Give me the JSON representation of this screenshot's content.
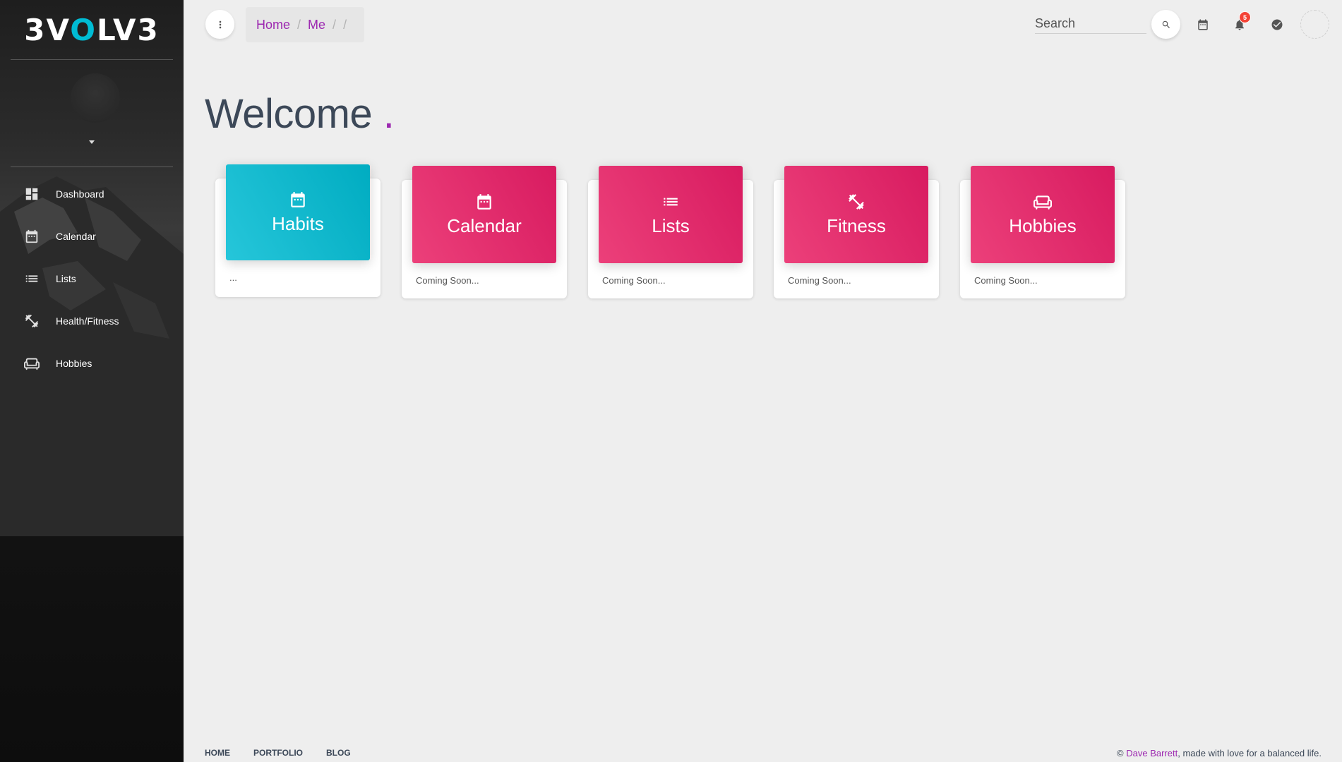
{
  "brand": {
    "left": "3V",
    "accent": "O",
    "right": "LV3"
  },
  "sidebar": {
    "items": [
      {
        "label": "Dashboard",
        "icon": "dashboard-icon"
      },
      {
        "label": "Calendar",
        "icon": "calendar-icon"
      },
      {
        "label": "Lists",
        "icon": "list-icon"
      },
      {
        "label": "Health/Fitness",
        "icon": "fitness-icon"
      },
      {
        "label": "Hobbies",
        "icon": "sofa-icon"
      }
    ]
  },
  "breadcrumb": {
    "items": [
      "Home",
      "Me"
    ],
    "separator": "/"
  },
  "search": {
    "placeholder": "Search"
  },
  "notifications": {
    "count": "5"
  },
  "welcome": {
    "text": "Welcome",
    "dot": "."
  },
  "cards": [
    {
      "title": "Habits",
      "footer": "...",
      "icon": "calendar-icon",
      "color": "#00bcd4"
    },
    {
      "title": "Calendar",
      "footer": "Coming Soon...",
      "icon": "calendar-icon",
      "color": "#e91e63"
    },
    {
      "title": "Lists",
      "footer": "Coming Soon...",
      "icon": "list-icon",
      "color": "#e91e63"
    },
    {
      "title": "Fitness",
      "footer": "Coming Soon...",
      "icon": "fitness-icon",
      "color": "#e91e63"
    },
    {
      "title": "Hobbies",
      "footer": "Coming Soon...",
      "icon": "sofa-icon",
      "color": "#e91e63"
    }
  ],
  "footer": {
    "links": [
      "HOME",
      "PORTFOLIO",
      "BLOG"
    ],
    "copyright_prefix": "©",
    "author": "Dave Barrett",
    "copyright_suffix": ", made with love for a balanced life."
  },
  "colors": {
    "primary": "#9c27b0",
    "info": "#00bcd4",
    "rose": "#e91e63",
    "badge": "#f44336"
  }
}
